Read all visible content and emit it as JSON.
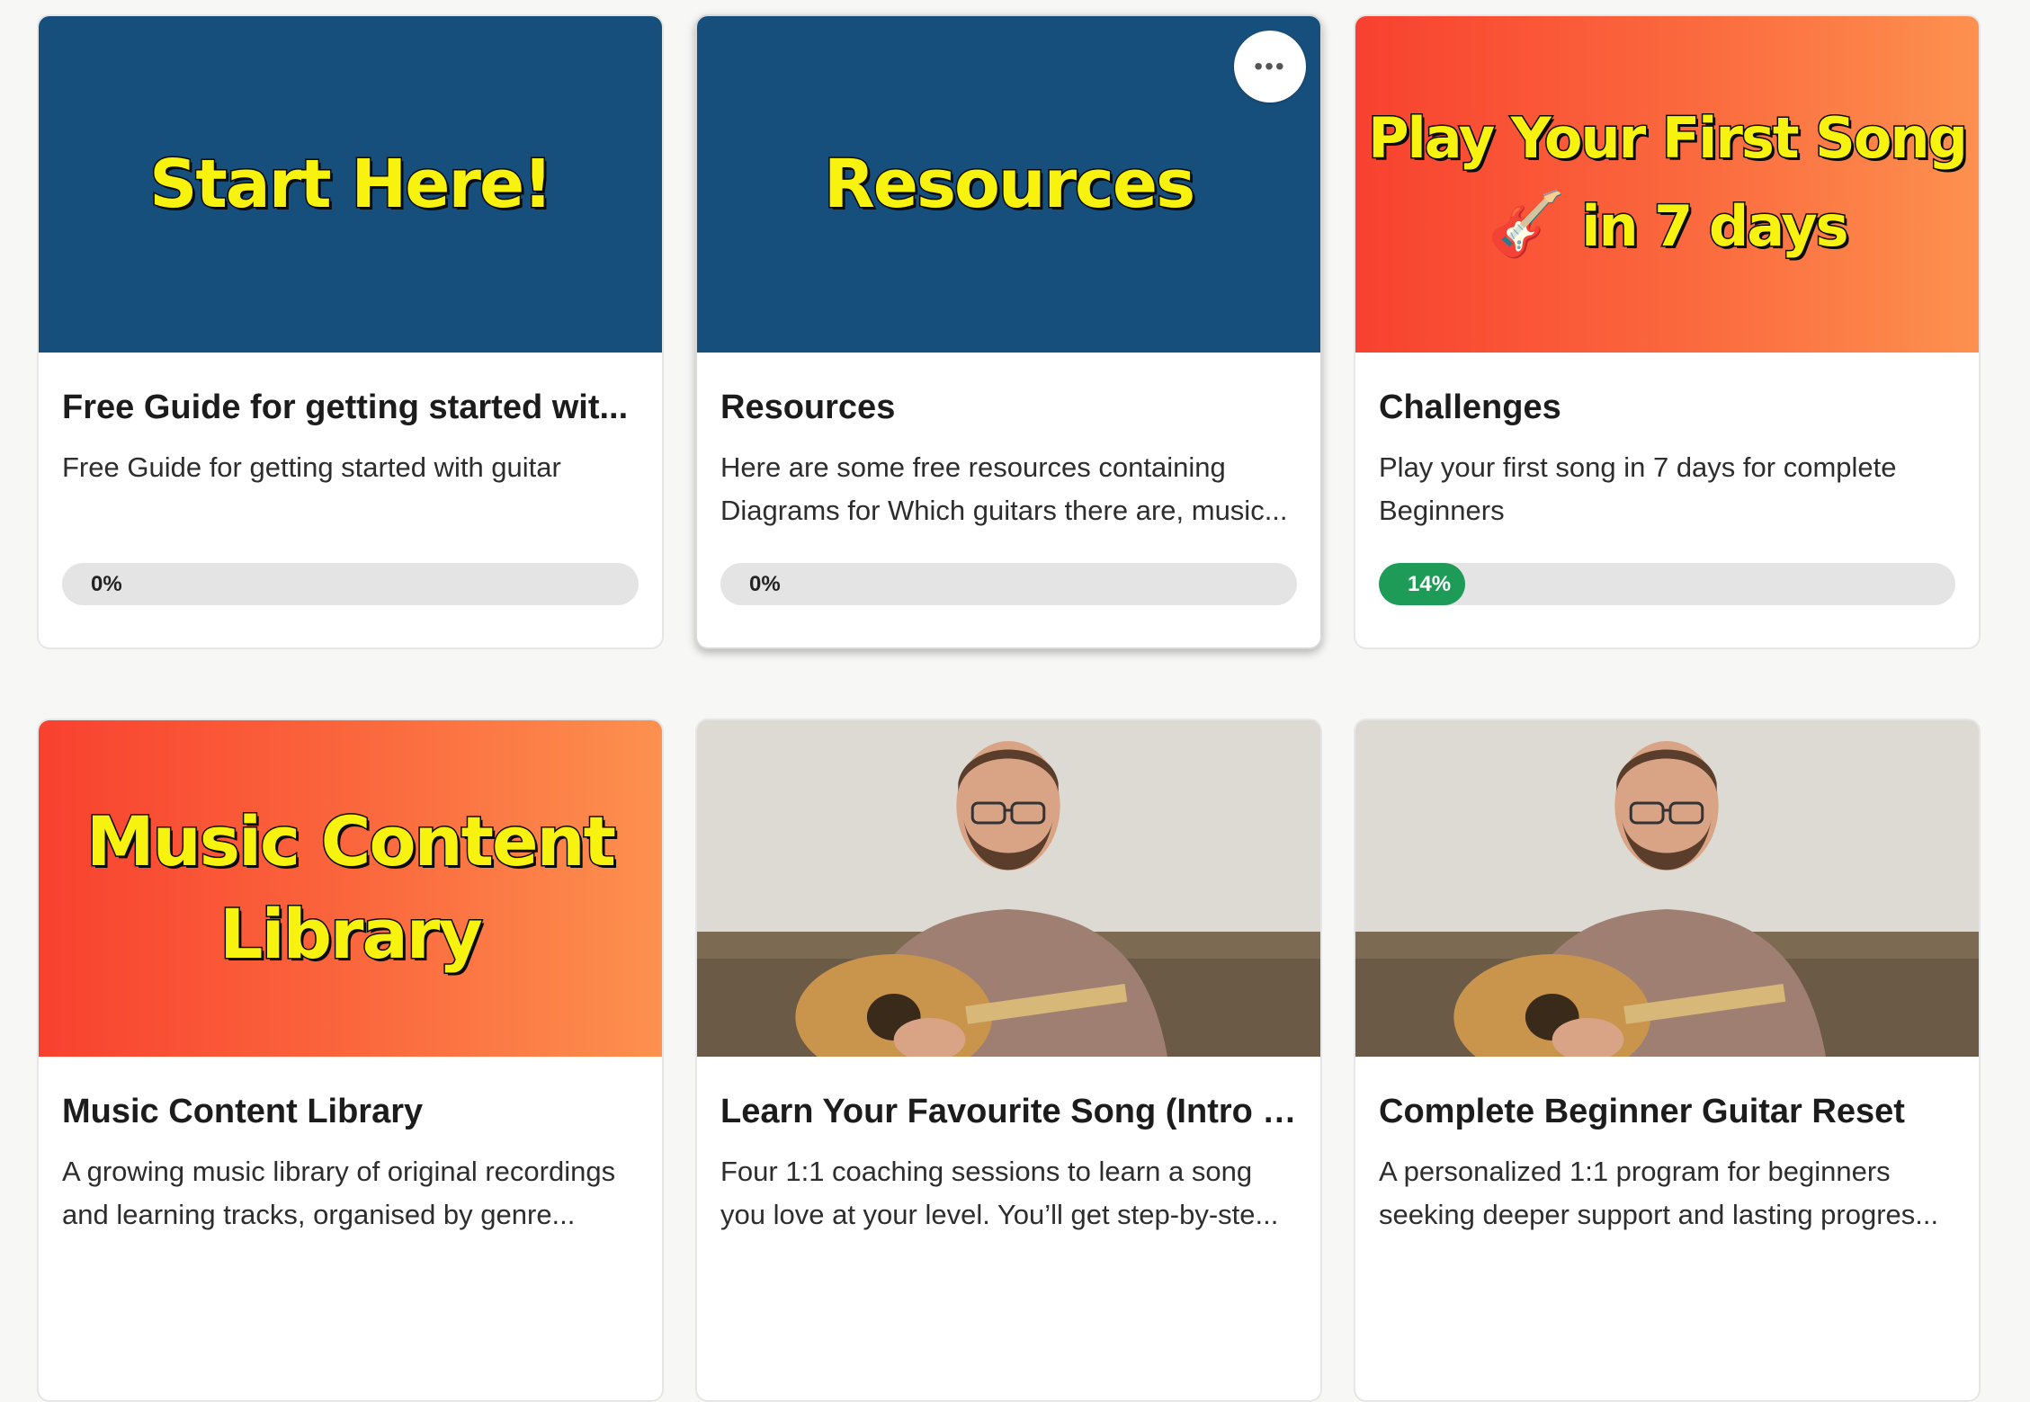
{
  "courses": [
    {
      "cover_text": "Start Here!",
      "title": "Free Guide for getting started wit...",
      "description": "Free Guide for getting started with guitar",
      "progress_label": "0%",
      "progress": 0
    },
    {
      "cover_text": "Resources",
      "title": "Resources",
      "description": "Here are some free resources containing Diagrams for Which guitars there are, music...",
      "progress_label": "0%",
      "progress": 0,
      "menu_icon": "more-options-icon"
    },
    {
      "cover_text_line1": "Play Your First Song",
      "cover_text_line2": "in 7 days",
      "cover_emoji": "🎸",
      "title": "Challenges",
      "description": "Play your first song in 7 days for complete Beginners",
      "progress_label": "14%",
      "progress": 0.14
    },
    {
      "cover_text_line1": "Music Content",
      "cover_text_line2": "Library",
      "title": "Music Content Library",
      "description": "A growing music library of original recordings and learning tracks, organised by genre..."
    },
    {
      "title": "Learn Your Favourite Song (Intro t...",
      "description": "Four 1:1 coaching sessions to learn a song you love at your level. You’ll get step-by-ste..."
    },
    {
      "title": "Complete Beginner Guitar Reset",
      "description": "A personalized 1:1 program for beginners seeking deeper support and lasting progres..."
    }
  ],
  "colors": {
    "blue_cover": "#174f7c",
    "orange_start": "#f8412f",
    "orange_end": "#fd914f",
    "progress_green": "#1f9b58",
    "cover_text_yellow": "#f7f20e"
  }
}
